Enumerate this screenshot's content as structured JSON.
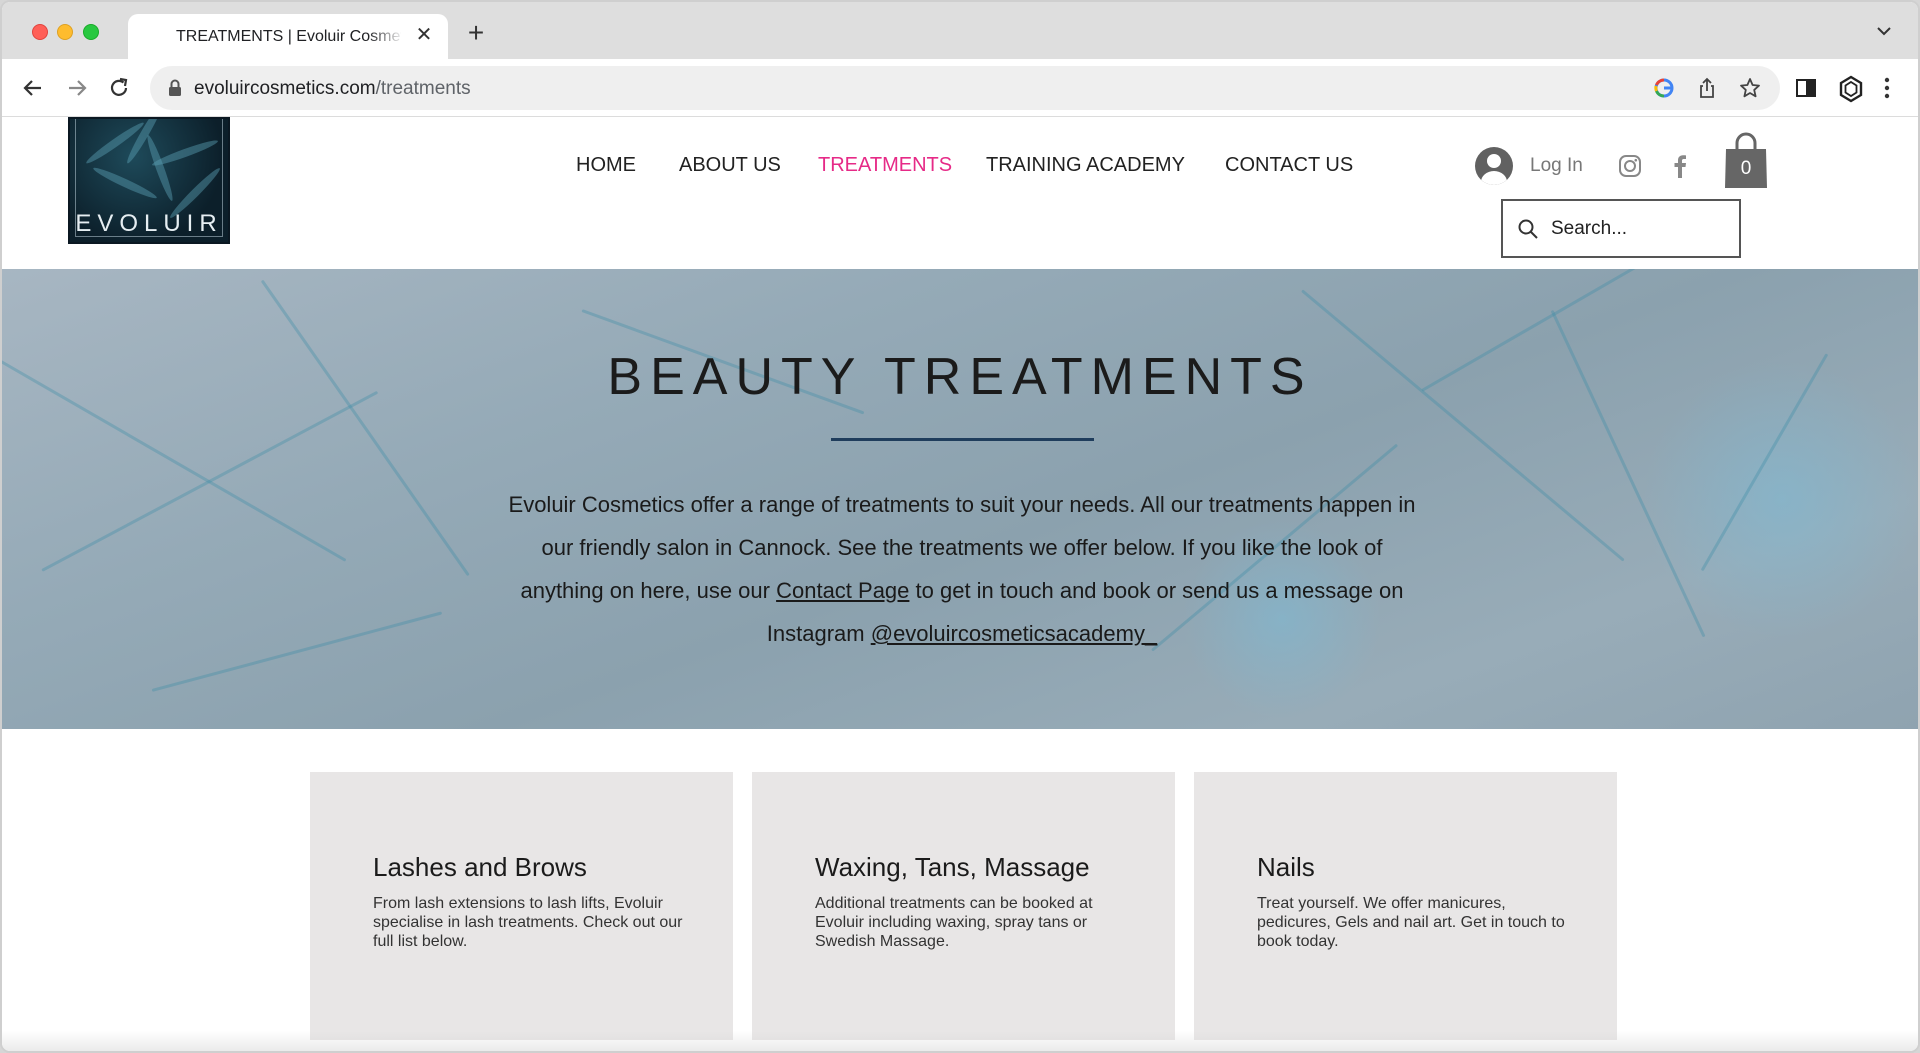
{
  "browser": {
    "tab_title": "TREATMENTS | Evoluir Cosmetics",
    "close_symbol": "✕",
    "new_tab_symbol": "+",
    "url_host": "evoluircosmetics.com",
    "url_path": "/treatments"
  },
  "site": {
    "logo_text": "EVOLUIR",
    "nav": [
      {
        "label": "HOME",
        "active": false
      },
      {
        "label": "ABOUT US",
        "active": false
      },
      {
        "label": "TREATMENTS",
        "active": true
      },
      {
        "label": "TRAINING ACADEMY",
        "active": false
      },
      {
        "label": "CONTACT US",
        "active": false
      }
    ],
    "login_label": "Log In",
    "cart_count": "0",
    "search_placeholder": "Search...",
    "accent_color": "#e62a87"
  },
  "hero": {
    "title": "BEAUTY TREATMENTS",
    "text_1": "Evoluir Cosmetics offer a range of treatments to suit your needs. All our treatments happen in our friendly salon in Cannock. See the treatments we offer below.  If you like the look of anything on here, use our ",
    "contact_link": "Contact Page",
    "text_2": " to get in touch and book or send us a message on Instagram ",
    "instagram_link": "@evoluircosmeticsacademy_"
  },
  "cards": [
    {
      "title": "Lashes and Brows",
      "text": "From lash extensions to lash lifts, Evoluir specialise in lash treatments. Check out our full list below."
    },
    {
      "title": "Waxing, Tans, Massage",
      "text": "Additional treatments can be booked at Evoluir including waxing, spray tans or Swedish Massage."
    },
    {
      "title": "Nails",
      "text": "Treat yourself. We offer manicures, pedicures, Gels and nail art. Get in touch to book today."
    }
  ],
  "icons": [
    "back-icon",
    "forward-icon",
    "reload-icon",
    "lock-icon",
    "google-icon",
    "share-icon",
    "bookmark-star-icon",
    "sidepanel-icon",
    "extension-icon",
    "kebab-menu-icon",
    "user-avatar-icon",
    "instagram-icon",
    "facebook-icon",
    "shopping-bag-icon",
    "search-icon"
  ]
}
